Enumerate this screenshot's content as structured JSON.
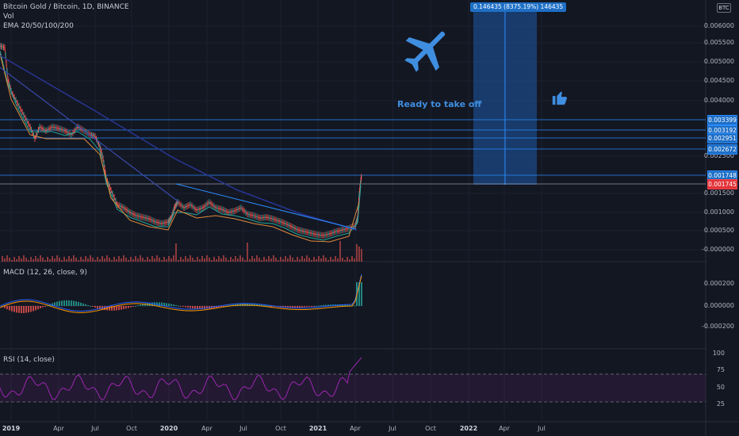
{
  "header": {
    "symbol": "Bitcoin Gold / Bitcoin, 1D, BINANCE",
    "vol": "Vol",
    "ema": "EMA 20/50/100/200",
    "currency_badge": "BTC"
  },
  "macd": {
    "label": "MACD (12, 26, close, 9)"
  },
  "rsi": {
    "label": "RSI (14, close)"
  },
  "annotations": {
    "takeoff_text": "Ready to take off",
    "measure_text": "0.146435 (8375.19%) 146435",
    "icons": [
      "airplane-icon",
      "thumbs-up-icon"
    ]
  },
  "price_axis": [
    "0.006000",
    "0.005500",
    "0.005000",
    "0.004500",
    "0.004000",
    "0.002500",
    "0.001500",
    "0.001000",
    "0.000500",
    "-0.000000"
  ],
  "price_tags": [
    {
      "value": "0.003399",
      "color": "blue"
    },
    {
      "value": "0.003192",
      "color": "blue"
    },
    {
      "value": "0.002951",
      "color": "blue"
    },
    {
      "value": "0.002672",
      "color": "blue"
    },
    {
      "value": "0.001748",
      "color": "blue"
    },
    {
      "value": "0.001745",
      "color": "red"
    }
  ],
  "macd_axis": [
    "0.000200",
    "0.000000",
    "-0.000200"
  ],
  "rsi_axis": [
    "100",
    "75",
    "50",
    "25"
  ],
  "time_axis": [
    {
      "label": "2019",
      "bold": true
    },
    {
      "label": "Apr",
      "bold": false
    },
    {
      "label": "Jul",
      "bold": false
    },
    {
      "label": "Oct",
      "bold": false
    },
    {
      "label": "2020",
      "bold": true
    },
    {
      "label": "Apr",
      "bold": false
    },
    {
      "label": "Jul",
      "bold": false
    },
    {
      "label": "Oct",
      "bold": false
    },
    {
      "label": "2021",
      "bold": true
    },
    {
      "label": "Apr",
      "bold": false
    },
    {
      "label": "Jul",
      "bold": false
    },
    {
      "label": "Oct",
      "bold": false
    },
    {
      "label": "2022",
      "bold": true
    },
    {
      "label": "Apr",
      "bold": false
    },
    {
      "label": "Jul",
      "bold": false
    }
  ],
  "colors": {
    "background": "#131722",
    "accent_blue": "#2a8cff",
    "candle_up": "#26a69a",
    "candle_down": "#ef5350",
    "rsi_line": "#9c27b0",
    "ema_navy": "#283593"
  }
}
